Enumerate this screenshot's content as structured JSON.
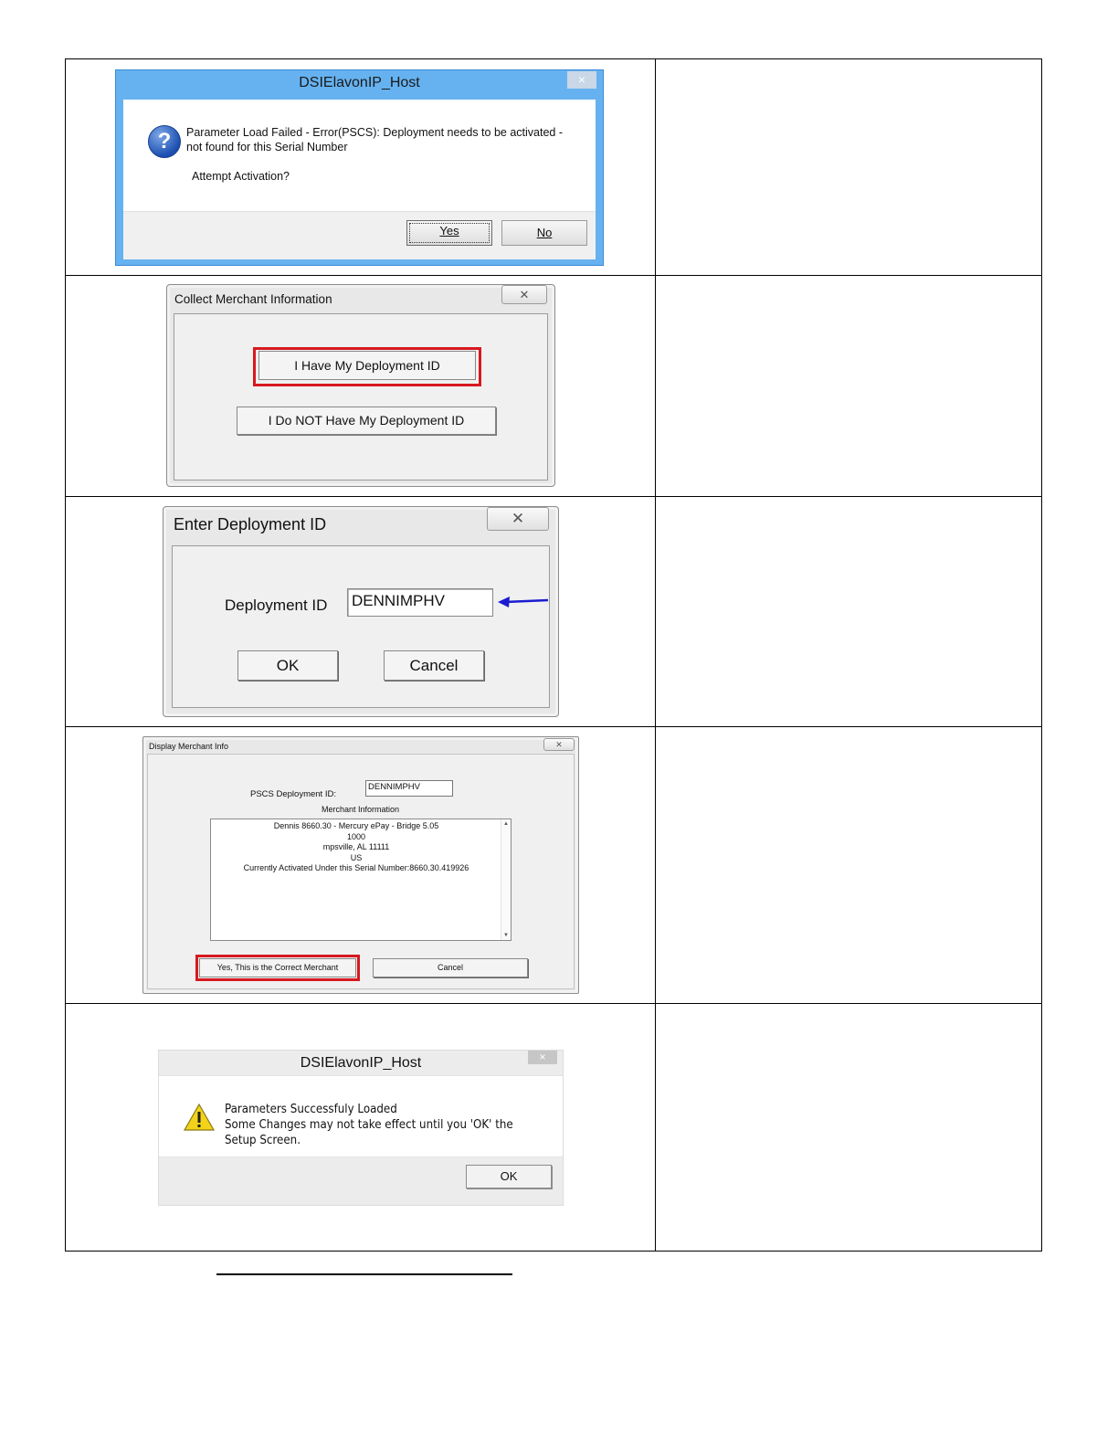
{
  "dialog1": {
    "title": "DSIElavonIP_Host",
    "close": "×",
    "message": "Parameter Load Failed - Error(PSCS): Deployment needs to be activated - not found for this Serial Number",
    "question": "Attempt Activation?",
    "yes": "Yes",
    "no": "No",
    "icon": "question-icon"
  },
  "dialog2": {
    "title": "Collect Merchant Information",
    "close": "✕",
    "have_id": "I Have My Deployment ID",
    "not_have_id": "I Do NOT Have My Deployment ID",
    "highlight_color": "#d7191f"
  },
  "dialog3": {
    "title": "Enter Deployment ID",
    "close": "✕",
    "field_label": "Deployment ID",
    "field_value": "DENNIMPHV",
    "ok": "OK",
    "cancel": "Cancel",
    "arrow_color": "#1b1bd1"
  },
  "dialog4": {
    "title": "Display Merchant Info",
    "close": "✕",
    "pscs_label": "PSCS Deployment ID:",
    "pscs_value": "DENNIMPHV",
    "merchant_label": "Merchant Information",
    "merchant_lines": [
      "Dennis 8660.30 - Mercury ePay - Bridge 5.05",
      "1000",
      "mpsville, AL 11111",
      "US",
      "Currently Activated Under this Serial Number:8660.30.419926"
    ],
    "confirm": "Yes, This is the Correct Merchant",
    "cancel": "Cancel"
  },
  "dialog5": {
    "title": "DSIElavonIP_Host",
    "close": "×",
    "line1": "Parameters Successfuly Loaded",
    "line2": "Some Changes may not take effect until you 'OK' the Setup Screen.",
    "ok": "OK",
    "icon": "warning-icon"
  }
}
